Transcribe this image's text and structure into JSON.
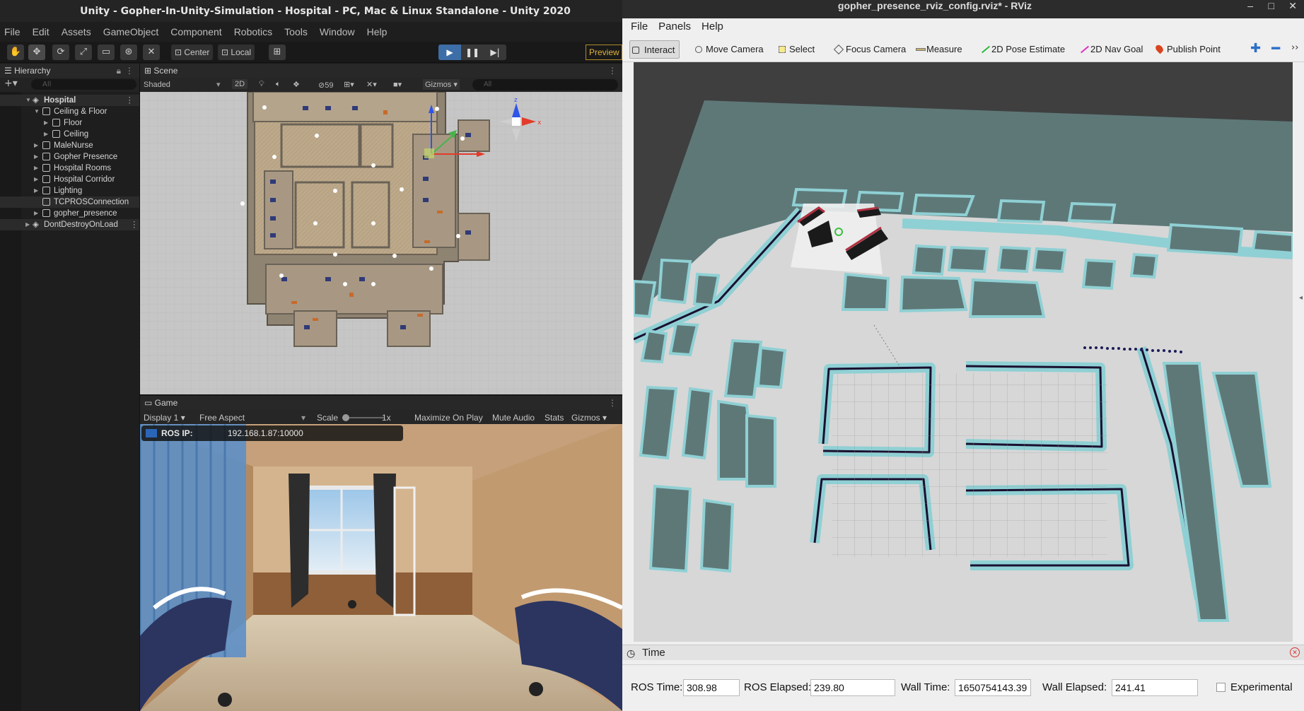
{
  "unity": {
    "title": "Unity - Gopher-In-Unity-Simulation - Hospital - PC, Mac & Linux Standalone - Unity 2020",
    "menu": [
      "File",
      "Edit",
      "Assets",
      "GameObject",
      "Component",
      "Robotics",
      "Tools",
      "Window",
      "Help"
    ],
    "toolbar": {
      "center": "Center",
      "local": "Local",
      "preview": "Preview"
    },
    "hierarchy": {
      "tab": "Hierarchy",
      "search_placeholder": "All",
      "root": "Hospital",
      "items": [
        {
          "label": "Ceiling & Floor",
          "level": 1,
          "expanded": true
        },
        {
          "label": "Floor",
          "level": 2
        },
        {
          "label": "Ceiling",
          "level": 2
        },
        {
          "label": "MaleNurse",
          "level": 1
        },
        {
          "label": "Gopher Presence",
          "level": 1
        },
        {
          "label": "Hospital Rooms",
          "level": 1
        },
        {
          "label": "Hospital Corridor",
          "level": 1
        },
        {
          "label": "Lighting",
          "level": 1
        },
        {
          "label": "TCPROSConnection",
          "level": 1,
          "selected": true
        },
        {
          "label": "gopher_presence",
          "level": 1
        }
      ],
      "scene2": "DontDestroyOnLoad"
    },
    "scene": {
      "tab": "Scene",
      "shading": "Shaded",
      "mode2d": "2D",
      "hidden_count": "59",
      "gizmos": "Gizmos",
      "search_placeholder": "All"
    },
    "game": {
      "tab": "Game",
      "display": "Display 1",
      "aspect": "Free Aspect",
      "scale_label": "Scale",
      "scale_value": "1x",
      "maximize": "Maximize On Play",
      "mute": "Mute Audio",
      "stats": "Stats",
      "gizmos": "Gizmos",
      "ros_ip_label": "ROS IP:",
      "ros_ip_value": "192.168.1.87:10000"
    }
  },
  "rviz": {
    "title": "gopher_presence_rviz_config.rviz* - RViz",
    "menu": [
      "File",
      "Panels",
      "Help"
    ],
    "tools": [
      {
        "label": "Interact",
        "icon": "hand-icon"
      },
      {
        "label": "Move Camera",
        "icon": "move-camera-icon"
      },
      {
        "label": "Select",
        "icon": "select-icon"
      },
      {
        "label": "Focus Camera",
        "icon": "focus-camera-icon"
      },
      {
        "label": "Measure",
        "icon": "ruler-icon"
      },
      {
        "label": "2D Pose Estimate",
        "icon": "pose-arrow-icon"
      },
      {
        "label": "2D Nav Goal",
        "icon": "nav-goal-arrow-icon"
      },
      {
        "label": "Publish Point",
        "icon": "map-pin-icon"
      }
    ],
    "time": {
      "header": "Time",
      "ros_time_label": "ROS Time:",
      "ros_time": "308.98",
      "ros_elapsed_label": "ROS Elapsed:",
      "ros_elapsed": "239.80",
      "wall_time_label": "Wall Time:",
      "wall_time": "1650754143.39",
      "wall_elapsed_label": "Wall Elapsed:",
      "wall_elapsed": "241.41",
      "experimental_label": "Experimental"
    }
  },
  "colors": {
    "map_free": "#d7d7d7",
    "map_unknown": "#5e7878",
    "map_inflation": "#8fd0d4",
    "obstacle": "#1a1030",
    "accent_blue": "#3a87d0"
  }
}
